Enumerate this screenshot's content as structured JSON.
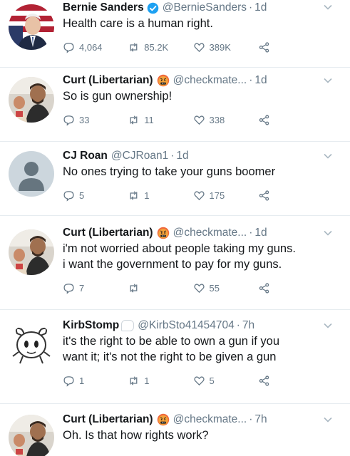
{
  "tweets": [
    {
      "name": "Bernie Sanders",
      "verified": true,
      "handle": "@BernieSanders",
      "time": "1d",
      "lines": [
        "Health care is a human right."
      ],
      "replies": "4,064",
      "retweets": "85.2K",
      "likes": "389K"
    },
    {
      "name": "Curt (Libertarian)",
      "emoji": "face-with-symbols-on-mouth-icon",
      "handle": "@checkmate...",
      "time": "1d",
      "lines": [
        "So is gun ownership!"
      ],
      "replies": "33",
      "retweets": "11",
      "likes": "338"
    },
    {
      "name": "CJ Roan",
      "handle": "@CJRoan1",
      "time": "1d",
      "lines": [
        "No ones trying to take your guns boomer"
      ],
      "replies": "5",
      "retweets": "1",
      "likes": "175"
    },
    {
      "name": "Curt (Libertarian)",
      "emoji": "face-with-symbols-on-mouth-icon",
      "handle": "@checkmate...",
      "time": "1d",
      "lines": [
        "i'm not worried about people taking my guns.",
        "i want the government to pay for my guns."
      ],
      "replies": "7",
      "retweets": "",
      "likes": "55"
    },
    {
      "name": "KirbStomp",
      "emoji": "speech-bubble-icon",
      "handle": "@KirbSto41454704",
      "time": "7h",
      "lines": [
        "it's the right to be able to own a gun if you",
        "want it; it's not the right to be given a gun"
      ],
      "replies": "1",
      "retweets": "1",
      "likes": "5"
    },
    {
      "name": "Curt (Libertarian)",
      "emoji": "face-with-symbols-on-mouth-icon",
      "handle": "@checkmate...",
      "time": "7h",
      "lines": [
        "Oh. Is that how rights work?"
      ],
      "replies": "",
      "retweets": "",
      "likes": ""
    }
  ],
  "colors": {
    "text": "#14171a",
    "secondary": "#657786",
    "verified": "#1da1f2",
    "divider": "#e6ecf0"
  }
}
